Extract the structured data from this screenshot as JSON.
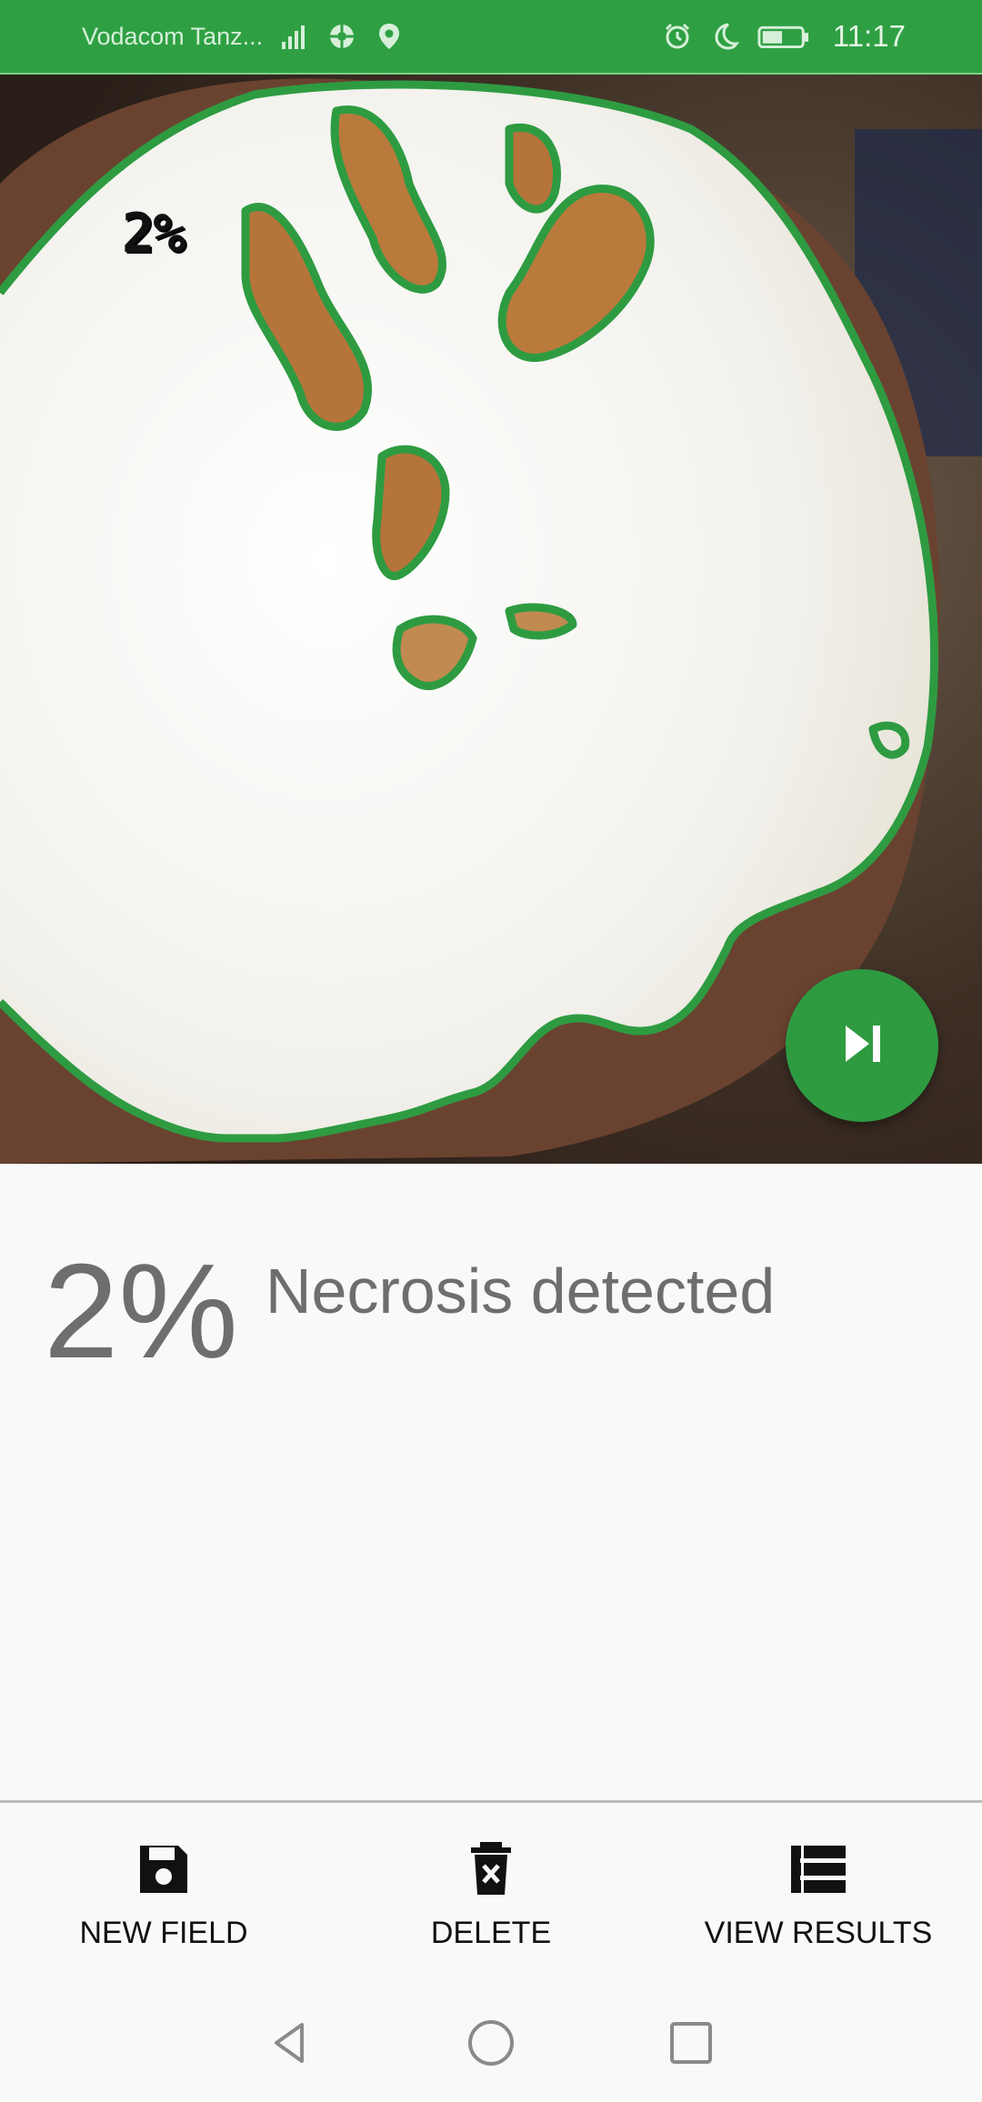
{
  "status_bar": {
    "carrier": "Vodacom Tanz...",
    "time": "11:17",
    "icons": [
      "signal-icon",
      "data-roaming-icon",
      "location-icon",
      "alarm-icon",
      "moon-icon",
      "battery-icon"
    ],
    "background_color": "#2ea043"
  },
  "photo": {
    "overlay_percent": "2%",
    "contour_color": "#2e9b41",
    "next_button_icon": "skip-next-icon"
  },
  "result": {
    "percent": "2%",
    "label": "Necrosis detected"
  },
  "bottom_nav": {
    "items": [
      {
        "label": "NEW FIELD",
        "icon": "save-icon"
      },
      {
        "label": "DELETE",
        "icon": "delete-icon"
      },
      {
        "label": "VIEW RESULTS",
        "icon": "list-icon"
      }
    ]
  },
  "system_nav": [
    "back-icon",
    "home-icon",
    "recents-icon"
  ]
}
